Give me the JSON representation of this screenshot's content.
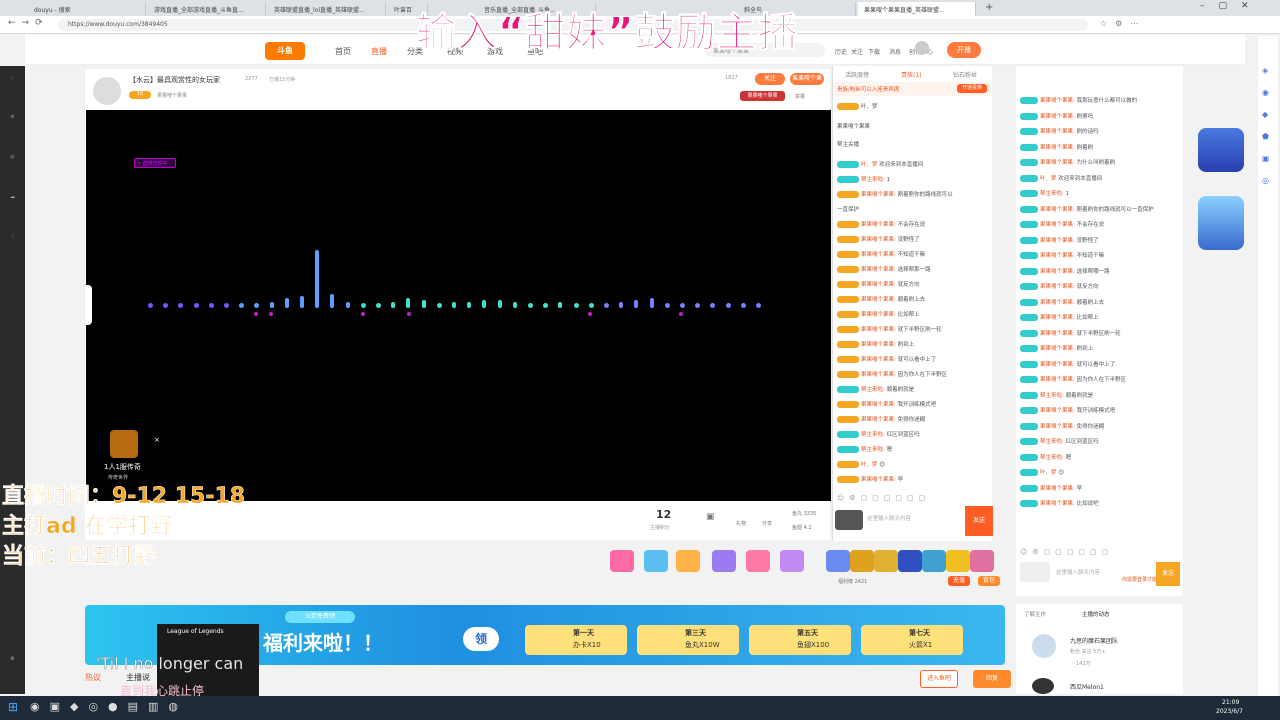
{
  "tabs": [
    "douyu - 搜索",
    "游戏直播_全部游戏直播_斗鱼直...",
    "英雄联盟直播_lol直播_英雄联盟...",
    "叶曾百",
    "音乐直播_全部直播_斗鱼...",
    "",
    "斜全鸟",
    "果果嗖个果果直播_英雄联盟..."
  ],
  "url": "https://www.douyu.com/3849405",
  "nav": {
    "home": "首页",
    "live": "直播",
    "category": "分类",
    "video": "视频",
    "game": "游戏",
    "fishbar": "鱼吧",
    "search_placeholder": "果果嗖个果果",
    "history": "历史",
    "follow": "关注",
    "download": "下载",
    "message": "消息",
    "creator": "创作中心",
    "start": "开播"
  },
  "overlay": {
    "title": "输入“甜妹”鼓励主播",
    "line1": "直播时间：9-12 15-18",
    "line2": "主打ad 在学打野",
    "line3": "当前：四五打野"
  },
  "room": {
    "tag": "【水云】",
    "title": "最具观赏性的女玩家",
    "hot": "2277",
    "status": "已播15分钟",
    "follow": "关注",
    "follow_count": "1827",
    "report": "举报",
    "name": "果果嗖个果果",
    "level": "16",
    "fans_badge": "果果嗖个果果",
    "live_label": "• 直播音频中",
    "popup_count": "1人1服传奇",
    "popup_sub": "传奇世界"
  },
  "stats": {
    "count": "12",
    "count_label": "主播积分",
    "gift": "礼物",
    "share": "分享",
    "fish_ball": "鱼丸",
    "fish_ball_val": "3335",
    "fish_wing": "鱼翅",
    "fish_wing_val": "4.2"
  },
  "tabs_right": {
    "contrib": "活跃度榜",
    "noble": "贵族(1)",
    "fans": "钻石粉丝"
  },
  "chat": {
    "notice": "贵族/粉丝可以入座贵宾席",
    "open": "开通贵族",
    "header_user": "叶、梦",
    "msg_intro": "果果嗖个果果",
    "help": "帮主关播",
    "input_placeholder": "这里输入聊天内容",
    "send": "发送"
  },
  "chat_msgs": [
    {
      "lvl": "g",
      "nick": "叶、梦",
      "text": "欢迎来到本直播间"
    },
    {
      "lvl": "g",
      "nick": "帮主来啦:",
      "text": "1"
    },
    {
      "lvl": "o",
      "nick": "果果嗖个果果:",
      "text": "刚着刚你的路线就可以"
    },
    {
      "lvl": "",
      "nick": "",
      "text": "一直保护"
    },
    {
      "lvl": "o",
      "nick": "果果嗖个果果:",
      "text": "不会存在说"
    },
    {
      "lvl": "o",
      "nick": "果果嗖个果果:",
      "text": "没野怪了"
    },
    {
      "lvl": "o",
      "nick": "果果嗖个果果:",
      "text": "不知道干嘛"
    },
    {
      "lvl": "o",
      "nick": "果果嗖个果果:",
      "text": "选择帮那一路"
    },
    {
      "lvl": "o",
      "nick": "果果嗖个果果:",
      "text": "就反方向"
    },
    {
      "lvl": "o",
      "nick": "果果嗖个果果:",
      "text": "顺着刷上去"
    },
    {
      "lvl": "o",
      "nick": "果果嗖个果果:",
      "text": "比如帮上"
    },
    {
      "lvl": "o",
      "nick": "果果嗖个果果:",
      "text": "就下半野区刷一轮"
    },
    {
      "lvl": "o",
      "nick": "果果嗖个果果:",
      "text": "刷到上"
    },
    {
      "lvl": "o",
      "nick": "果果嗖个果果:",
      "text": "就可以看中上了"
    },
    {
      "lvl": "o",
      "nick": "果果嗖个果果:",
      "text": "因为你人在下半野区"
    },
    {
      "lvl": "g",
      "nick": "帮主来啦:",
      "text": "顺着刷就是"
    },
    {
      "lvl": "o",
      "nick": "果果嗖个果果:",
      "text": "我开训练模式吧"
    },
    {
      "lvl": "o",
      "nick": "果果嗖个果果:",
      "text": "免得你迷糊"
    },
    {
      "lvl": "g",
      "nick": "帮主来啦:",
      "text": "红区到蓝区吗"
    },
    {
      "lvl": "g",
      "nick": "帮主来啦:",
      "text": "嗯"
    },
    {
      "lvl": "o",
      "nick": "叶、梦",
      "text": "😊"
    },
    {
      "lvl": "o",
      "nick": "果果嗖个果果:",
      "text": "早"
    }
  ],
  "right_msgs": [
    {
      "nick": "果果嗖个果果:",
      "text": "我那玩意什么都可以做的"
    },
    {
      "nick": "果果嗖个果果:",
      "text": "刷擦吗"
    },
    {
      "nick": "果果嗖个果果:",
      "text": "刷的话吗"
    },
    {
      "nick": "果果嗖个果果:",
      "text": "刷着刷"
    },
    {
      "nick": "果果嗖个果果:",
      "text": "为什么叫刷着刷"
    },
    {
      "nick": "叶、梦",
      "text": "欢迎来到本直播间"
    },
    {
      "nick": "帮主来啦:",
      "text": "1"
    },
    {
      "nick": "果果嗖个果果:",
      "text": "刚着刷你的路线就可以一直保护"
    },
    {
      "nick": "果果嗖个果果:",
      "text": "不会存在说"
    },
    {
      "nick": "果果嗖个果果:",
      "text": "没野怪了"
    },
    {
      "nick": "果果嗖个果果:",
      "text": "不知道干嘛"
    },
    {
      "nick": "果果嗖个果果:",
      "text": "选择帮哪一路"
    },
    {
      "nick": "果果嗖个果果:",
      "text": "就反方向"
    },
    {
      "nick": "果果嗖个果果:",
      "text": "顺着刷上去"
    },
    {
      "nick": "果果嗖个果果:",
      "text": "比如帮上"
    },
    {
      "nick": "果果嗖个果果:",
      "text": "就下半野区刷一轮"
    },
    {
      "nick": "果果嗖个果果:",
      "text": "刷到上"
    },
    {
      "nick": "果果嗖个果果:",
      "text": "就可以看中上了"
    },
    {
      "nick": "果果嗖个果果:",
      "text": "因为你人在下半野区"
    },
    {
      "nick": "帮主来啦:",
      "text": "顺着刷就是"
    },
    {
      "nick": "果果嗖个果果:",
      "text": "我开训练模式吧"
    },
    {
      "nick": "果果嗖个果果:",
      "text": "免得你迷糊"
    },
    {
      "nick": "帮主来啦:",
      "text": "红区到蓝区吗"
    },
    {
      "nick": "帮主来啦:",
      "text": "嗯"
    },
    {
      "nick": "叶、梦",
      "text": "😊"
    },
    {
      "nick": "果果嗖个果果:",
      "text": "早"
    },
    {
      "nick": "果果嗖个果果:",
      "text": "比如说吧"
    }
  ],
  "right": {
    "input_placeholder": "这里输入聊天内容",
    "send": "发送",
    "input_hint": "你需要登录才能弹幕",
    "tab1": "了解主作",
    "tab2": "主播的动态",
    "user1": "九思的魔石果团队",
    "user1_sub": "粉丝·关注 5万+",
    "user1_fans": "143万",
    "user2": "西瓜Melon1"
  },
  "banner": {
    "badge": "火箭免费领",
    "title": "福利来啦！！",
    "btn": "领",
    "day1": "第一天",
    "day1_sub": "办卡X10",
    "day3": "第三天",
    "day3_sub": "鱼丸X10W",
    "day5": "第五天",
    "day5_sub": "鱼翅X100",
    "day7": "第七天",
    "day7_sub": "火箭X1"
  },
  "bottom": {
    "lol": "League of Legends",
    "lyric1": "'Til I no longer can",
    "lyric2": "直到我心跳止停",
    "hot": "热议",
    "anchor_say": "主播说",
    "fav": "进入鱼吧",
    "recommend": "回复",
    "ranking": "福利榜",
    "rank_val": "2421",
    "btn_a": "充值",
    "btn_b": "背包"
  },
  "system": {
    "time": "21:09",
    "date": "2023/6/7"
  }
}
